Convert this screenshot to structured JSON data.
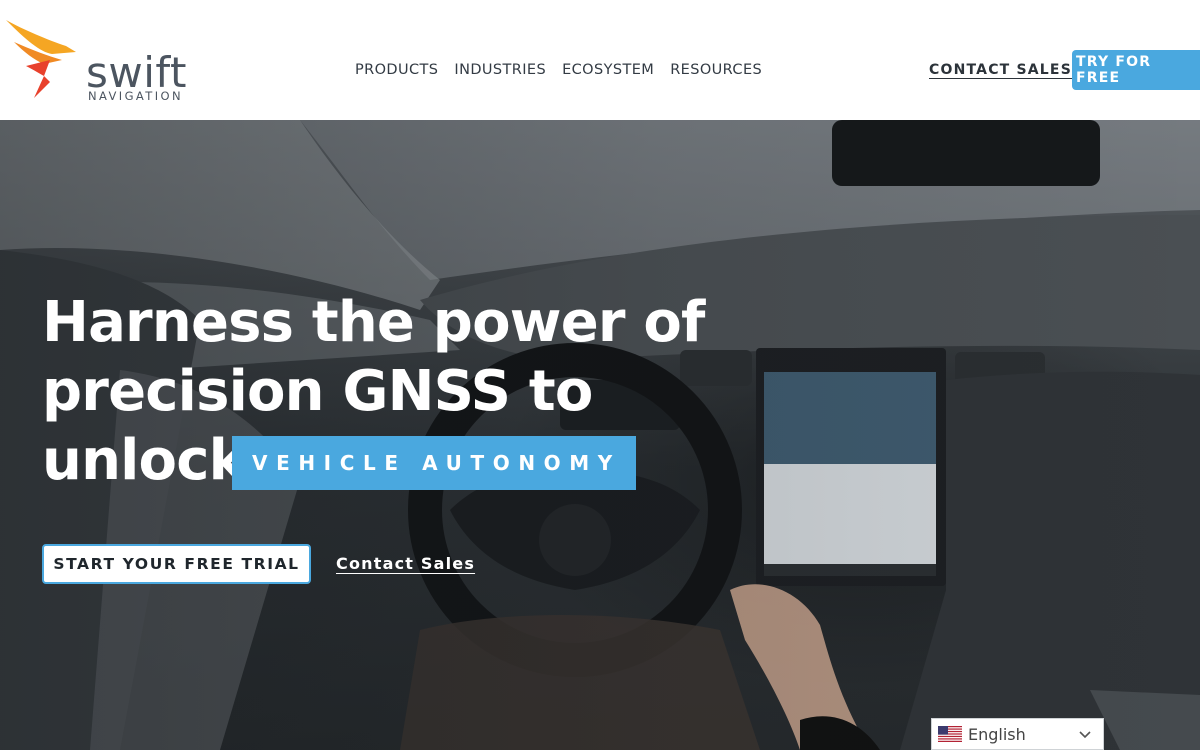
{
  "brand": {
    "name": "swift",
    "sub": "NAVIGATION",
    "colors": {
      "orange": "#f5a623",
      "red": "#e8412c",
      "text": "#4c5560",
      "accent": "#4aa8df"
    }
  },
  "nav": {
    "items": [
      "PRODUCTS",
      "INDUSTRIES",
      "ECOSYSTEM",
      "RESOURCES"
    ],
    "contact_sales": "CONTACT SALES",
    "try_free": "TRY FOR FREE"
  },
  "hero": {
    "headline_lines": [
      "Harness the power of",
      "precision GNSS to",
      "unlock"
    ],
    "badge": "VEHICLE AUTONOMY",
    "cta_trial": "START YOUR FREE TRIAL",
    "cta_contact": "Contact Sales"
  },
  "language": {
    "selected": "English",
    "flag": "us-flag-icon"
  }
}
